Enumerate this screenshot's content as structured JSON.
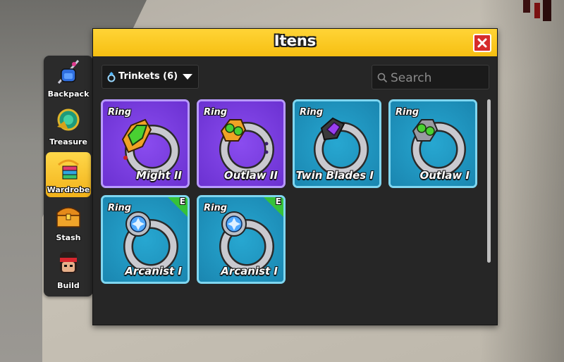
{
  "sidebar": {
    "items": [
      {
        "label": "Backpack",
        "icon": "backpack-icon",
        "active": false
      },
      {
        "label": "Treasure",
        "icon": "treasure-icon",
        "active": false
      },
      {
        "label": "Wardrobe",
        "icon": "wardrobe-icon",
        "active": true
      },
      {
        "label": "Stash",
        "icon": "stash-chest-icon",
        "active": false
      },
      {
        "label": "Build",
        "icon": "build-avatar-icon",
        "active": false
      }
    ]
  },
  "window": {
    "title": "Itens",
    "close_icon": "close-icon",
    "accent_color": "#f6bf12",
    "close_color": "#d62c2c"
  },
  "filter": {
    "selected": "Trinkets (6)",
    "icon": "ring-icon"
  },
  "search": {
    "placeholder": "Search",
    "value": ""
  },
  "items": [
    {
      "type": "Ring",
      "name": "Might II",
      "rarity_color": "#7a3fe0",
      "gem": "green-gem",
      "equipped": false
    },
    {
      "type": "Ring",
      "name": "Outlaw II",
      "rarity_color": "#7a3fe0",
      "gem": "twin-green-gems",
      "equipped": false
    },
    {
      "type": "Ring",
      "name": "Twin Blades I",
      "rarity_color": "#1f95bf",
      "gem": "purple-gem",
      "equipped": false
    },
    {
      "type": "Ring",
      "name": "Outlaw I",
      "rarity_color": "#1f95bf",
      "gem": "twin-green-gems",
      "equipped": false
    },
    {
      "type": "Ring",
      "name": "Arcanist I",
      "rarity_color": "#1f95bf",
      "gem": "blue-cross-gem",
      "equipped": true
    },
    {
      "type": "Ring",
      "name": "Arcanist I",
      "rarity_color": "#1f95bf",
      "gem": "blue-cross-gem",
      "equipped": true
    }
  ],
  "equipped_badge": "E"
}
